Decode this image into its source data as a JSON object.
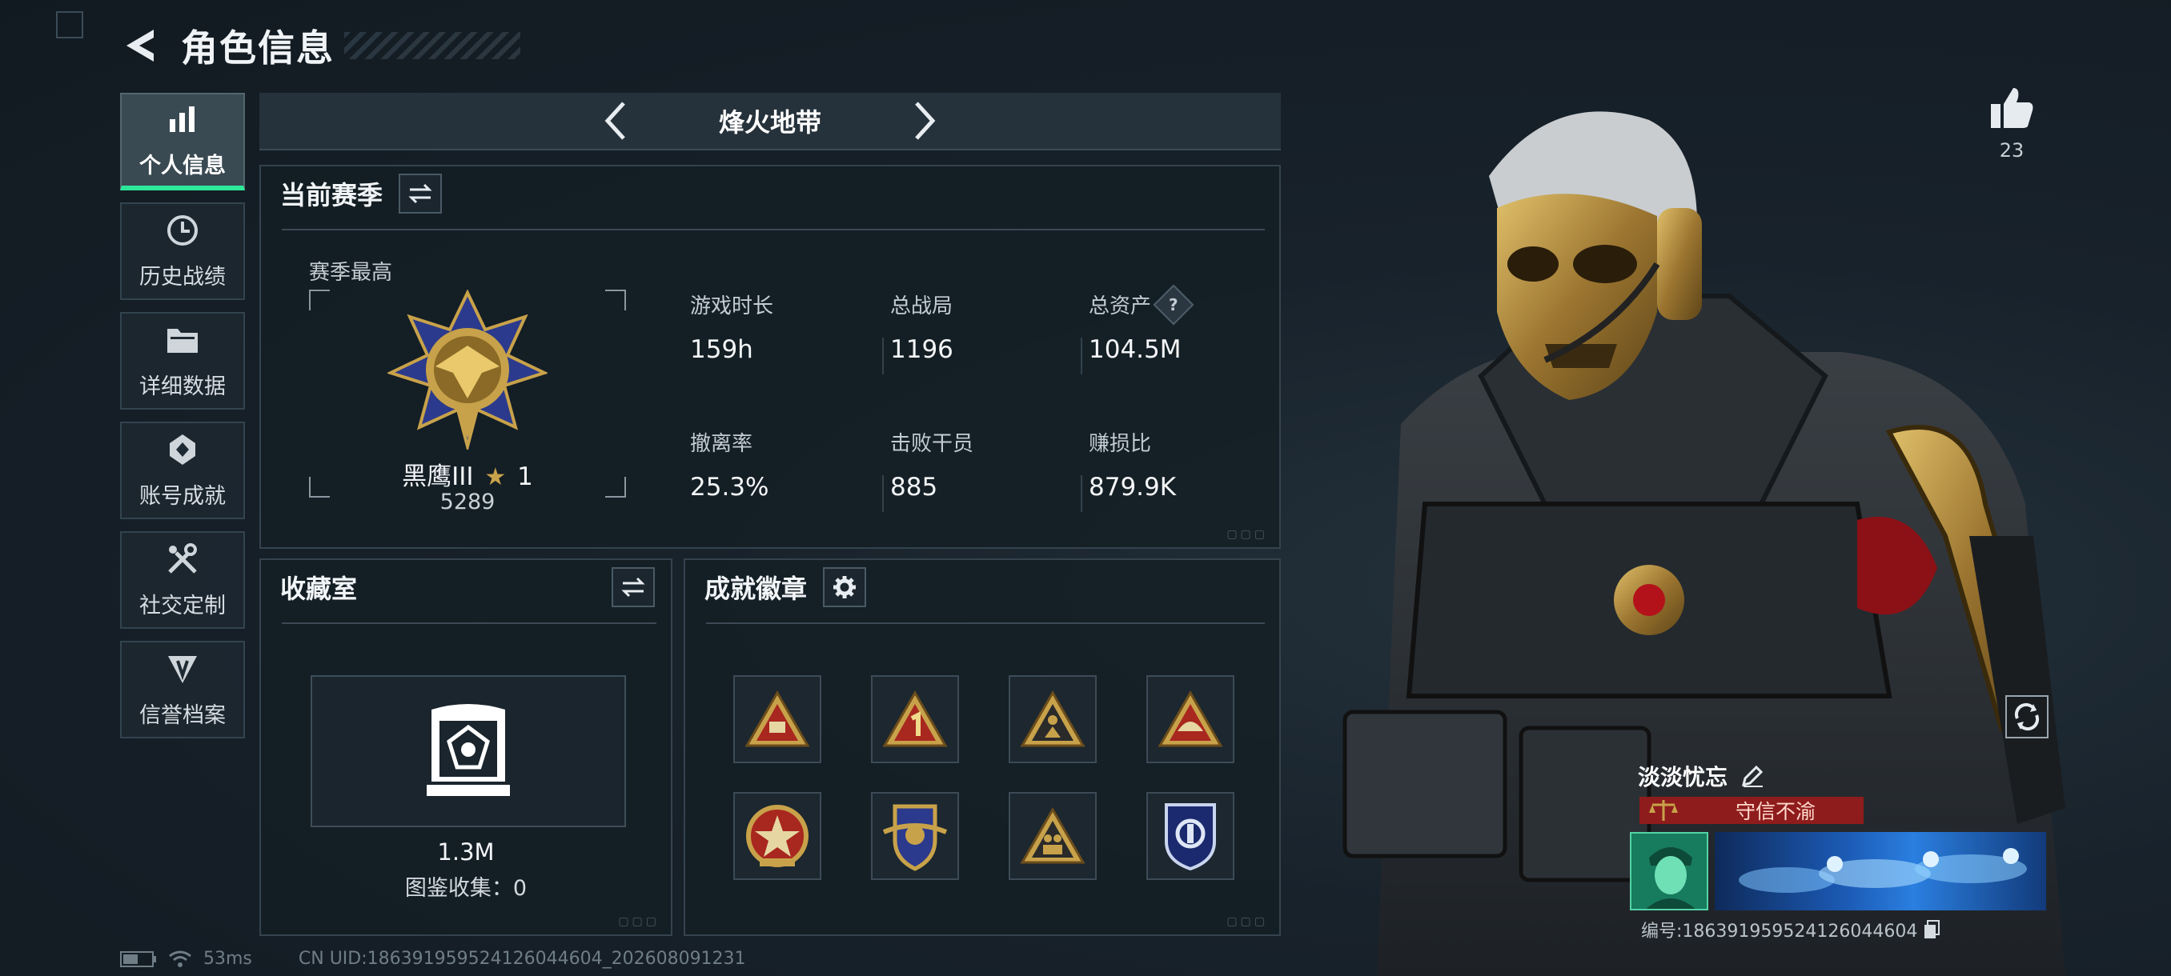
{
  "header": {
    "title": "角色信息"
  },
  "nav": {
    "items": [
      {
        "label": "个人信息",
        "icon": "bar-chart-icon",
        "active": true
      },
      {
        "label": "历史战绩",
        "icon": "history-icon",
        "active": false
      },
      {
        "label": "详细数据",
        "icon": "folder-icon",
        "active": false
      },
      {
        "label": "账号成就",
        "icon": "achievement-icon",
        "active": false
      },
      {
        "label": "社交定制",
        "icon": "tools-icon",
        "active": false
      },
      {
        "label": "信誉档案",
        "icon": "credit-icon",
        "active": false
      }
    ]
  },
  "mode": {
    "name": "烽火地带"
  },
  "season": {
    "title": "当前赛季",
    "best_label": "赛季最高",
    "rank_name": "黑鹰III",
    "rank_stars": "1",
    "rank_points": "5289",
    "stats": [
      {
        "label": "游戏时长",
        "value": "159h"
      },
      {
        "label": "总战局",
        "value": "1196"
      },
      {
        "label": "总资产",
        "value": "104.5M",
        "help": "?"
      },
      {
        "label": "撤离率",
        "value": "25.3%"
      },
      {
        "label": "击败干员",
        "value": "885"
      },
      {
        "label": "赚损比",
        "value": "879.9K"
      }
    ]
  },
  "collection": {
    "title": "收藏室",
    "value": "1.3M",
    "count_label": "图鉴收集：0"
  },
  "badges": {
    "title": "成就徽章",
    "count": 8
  },
  "footer": {
    "ping": "53ms",
    "uid": "CN UID:18639195952412604460​4_202608091231"
  },
  "like": {
    "count": "23"
  },
  "card": {
    "name": "淡淡忧忘",
    "title_tag": "守信不渝",
    "id_line": "编号:18639195952412604460​4"
  },
  "colors": {
    "accent": "#2ee89a",
    "gold": "#c8a24a",
    "tag_red": "#8f1c1c"
  }
}
